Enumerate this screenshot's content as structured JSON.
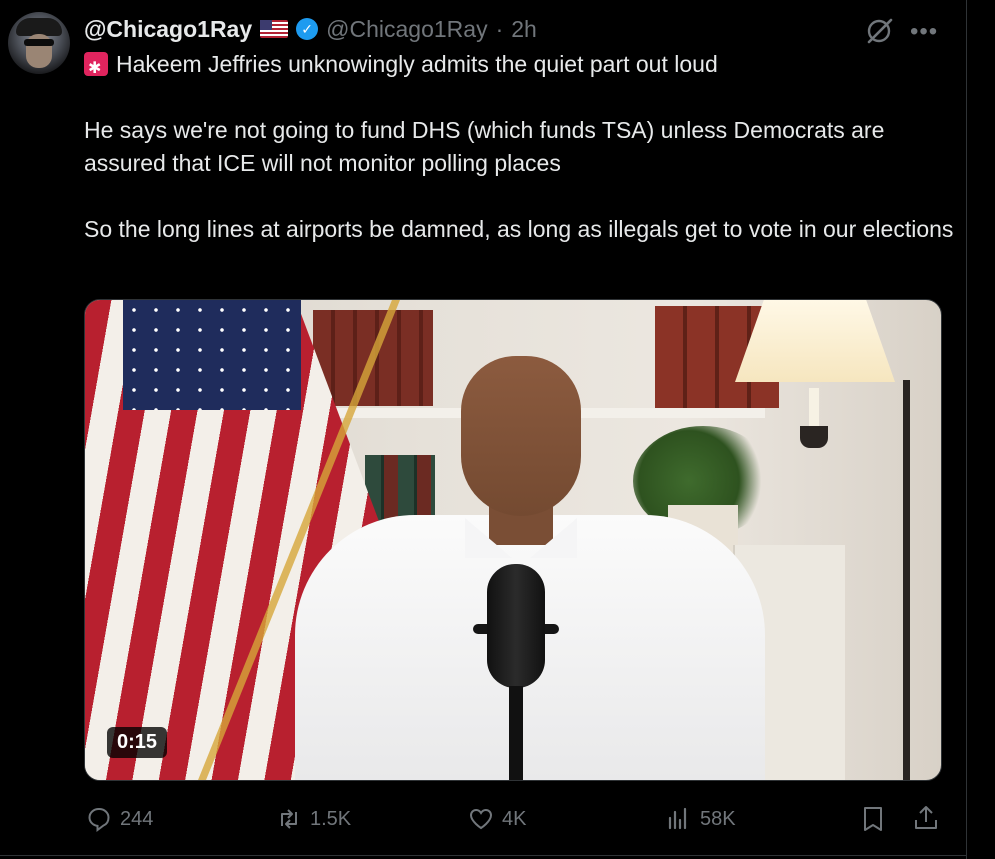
{
  "post": {
    "display_name": "@Chicago1Ray",
    "handle": "@Chicago1Ray",
    "separator": "·",
    "timestamp": "2h",
    "text_line1": "Hakeem Jeffries unknowingly admits the quiet part out loud",
    "text_para2": "He says we're not going to fund DHS (which funds TSA) unless Democrats are assured that ICE will not monitor polling places",
    "text_para3": "So the long lines at airports be damned, as long as illegals get to vote in our elections"
  },
  "media": {
    "duration": "0:15"
  },
  "metrics": {
    "replies": "244",
    "reposts": "1.5K",
    "likes": "4K",
    "views": "58K"
  },
  "icons": {
    "flag": "us-flag-emoji",
    "verified": "verified-badge-icon",
    "grok": "grok-icon",
    "more": "more-icon",
    "siren": "siren-emoji",
    "reply": "reply-icon",
    "repost": "repost-icon",
    "like": "heart-icon",
    "views": "views-icon",
    "bookmark": "bookmark-icon",
    "share": "share-icon"
  },
  "colors": {
    "background": "#000000",
    "text": "#e7e9ea",
    "secondary": "#71767b",
    "accent": "#1d9bf0"
  }
}
